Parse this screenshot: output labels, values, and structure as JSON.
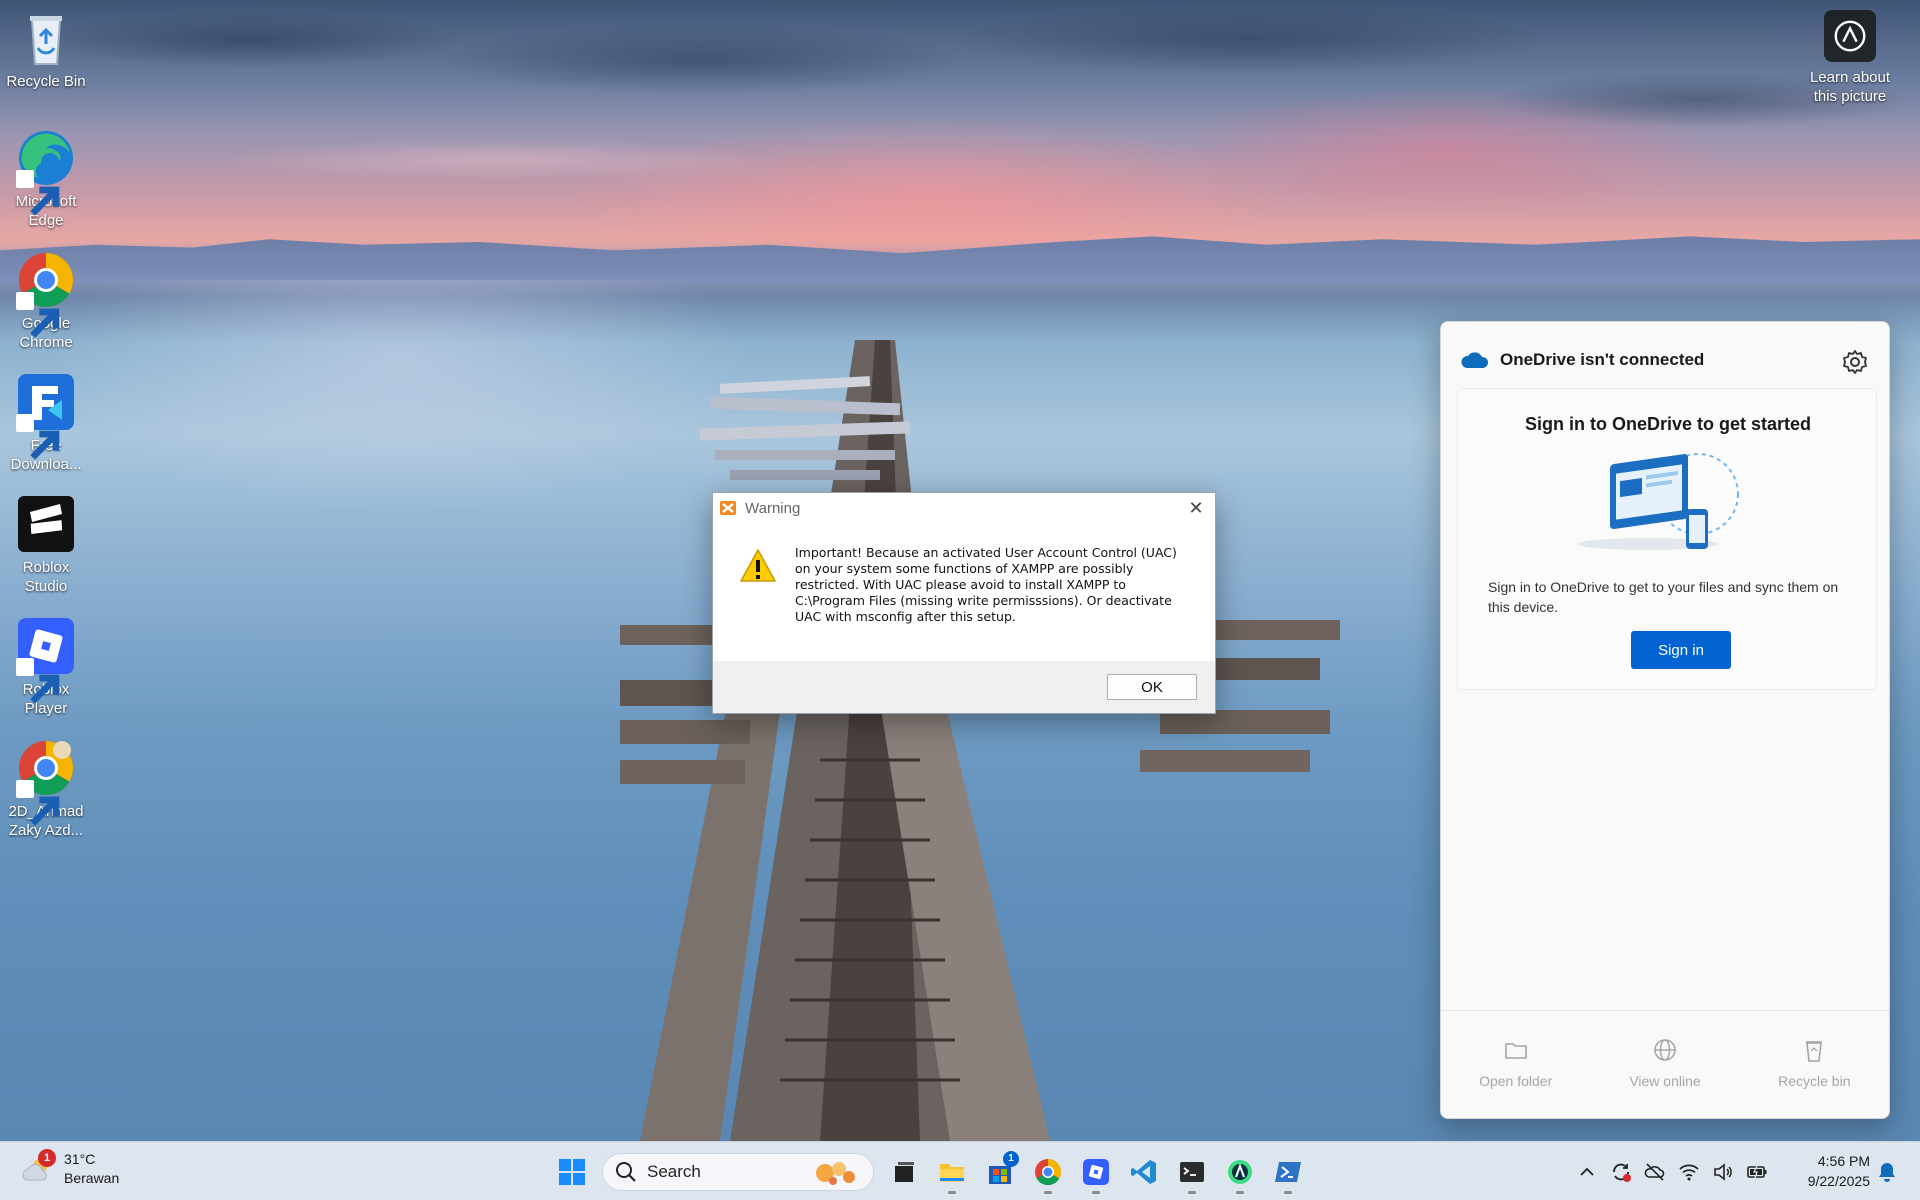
{
  "desktop": {
    "icons": [
      {
        "label": "Recycle Bin"
      },
      {
        "label": "Microsoft Edge"
      },
      {
        "label": "Google Chrome"
      },
      {
        "label": "Free Downloa..."
      },
      {
        "label": "Roblox Studio"
      },
      {
        "label": "Roblox Player"
      },
      {
        "label": "2D_Ahmad Zaky Azd..."
      }
    ],
    "learn_label": "Learn about this picture"
  },
  "dialog": {
    "title": "Warning",
    "message": "Important! Because an activated User Account Control (UAC) on your system some functions of XAMPP are possibly restricted. With UAC please avoid to install XAMPP to C:\\Program Files (missing write permisssions). Or deactivate UAC with msconfig after this setup.",
    "ok_label": "OK"
  },
  "onedrive": {
    "header": "OneDrive isn't connected",
    "card_title": "Sign in to OneDrive to get started",
    "description": "Sign in to OneDrive to get to your files and sync them on this device.",
    "sign_in_label": "Sign in",
    "actions": [
      {
        "label": "Open folder",
        "icon": "folder-icon"
      },
      {
        "label": "View online",
        "icon": "globe-icon"
      },
      {
        "label": "Recycle bin",
        "icon": "recycle-bin-icon"
      }
    ]
  },
  "taskbar": {
    "weather": {
      "temp": "31°C",
      "condition": "Berawan",
      "badge": "1"
    },
    "search_placeholder": "Search",
    "store_badge": "1",
    "time": "4:56 PM",
    "date": "9/22/2025",
    "apps": [
      "task-view",
      "file-explorer",
      "microsoft-store",
      "chrome",
      "roblox",
      "vs-code",
      "terminal",
      "android-studio",
      "powershell"
    ]
  },
  "colors": {
    "accent": "#0063d1",
    "taskbar": "#dde6ef",
    "badge_red": "#d42a2a"
  }
}
